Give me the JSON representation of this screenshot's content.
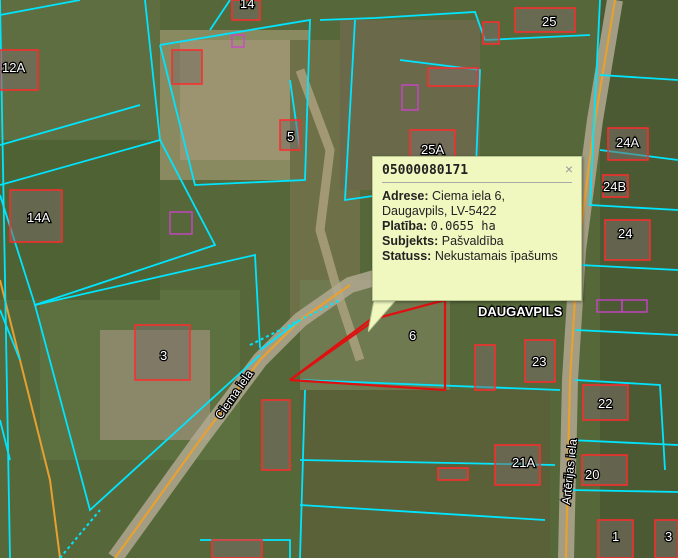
{
  "colors": {
    "parcel_boundary": "#00e5ff",
    "building": "#ff2a2a",
    "road": "#e8a030",
    "selected_parcel": "#e01010"
  },
  "map": {
    "city_label": "DAUGAVPILS",
    "street_labels": [
      "Ciema iela",
      "Artērijas iela"
    ],
    "parcel_numbers": [
      "14",
      "25",
      "12A",
      "5",
      "25A",
      "24A",
      "24B",
      "14A",
      "24",
      "6",
      "3",
      "23",
      "22",
      "21A",
      "20",
      "1",
      "3"
    ]
  },
  "popup": {
    "parcel_id": "05000080171",
    "close_symbol": "×",
    "fields": [
      {
        "key": "Adrese:",
        "value": "Ciema iela 6, Daugavpils, LV-5422"
      },
      {
        "key": "Platība:",
        "value": "0.0655 ha"
      },
      {
        "key": "Subjekts:",
        "value": "Pašvaldība"
      },
      {
        "key": "Statuss:",
        "value": "Nekustamais īpašums"
      }
    ]
  }
}
